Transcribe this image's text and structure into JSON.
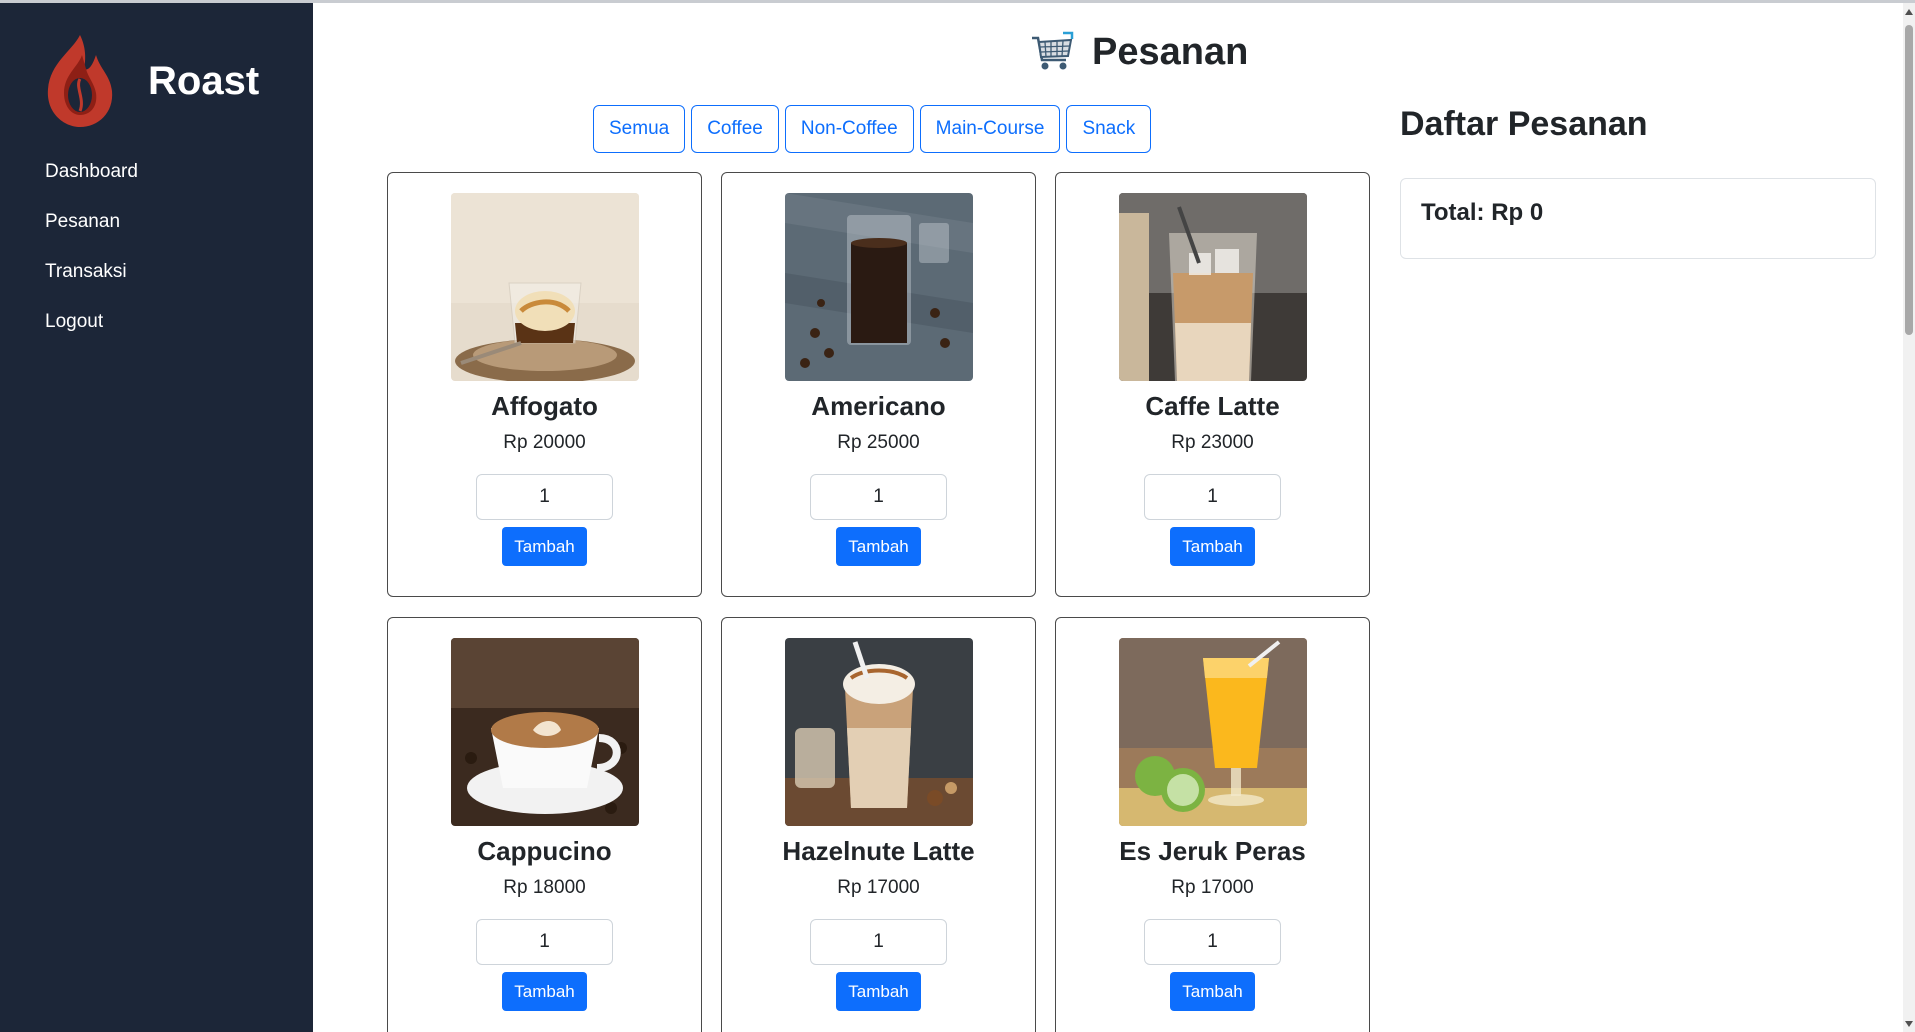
{
  "brand": {
    "name": "Roast",
    "logo_icon": "flame-coffee-bean-icon"
  },
  "sidebar": {
    "items": [
      {
        "label": "Dashboard"
      },
      {
        "label": "Pesanan"
      },
      {
        "label": "Transaksi"
      },
      {
        "label": "Logout"
      }
    ]
  },
  "header": {
    "title": "Pesanan",
    "icon": "cart-icon"
  },
  "filters": [
    {
      "label": "Semua"
    },
    {
      "label": "Coffee"
    },
    {
      "label": "Non-Coffee"
    },
    {
      "label": "Main-Course"
    },
    {
      "label": "Snack"
    }
  ],
  "products": [
    {
      "name": "Affogato",
      "price": "Rp 20000",
      "qty": "1",
      "button": "Tambah"
    },
    {
      "name": "Americano",
      "price": "Rp 25000",
      "qty": "1",
      "button": "Tambah"
    },
    {
      "name": "Caffe Latte",
      "price": "Rp 23000",
      "qty": "1",
      "button": "Tambah"
    },
    {
      "name": "Cappucino",
      "price": "Rp 18000",
      "qty": "1",
      "button": "Tambah"
    },
    {
      "name": "Hazelnute Latte",
      "price": "Rp 17000",
      "qty": "1",
      "button": "Tambah"
    },
    {
      "name": "Es Jeruk Peras",
      "price": "Rp 17000",
      "qty": "1",
      "button": "Tambah"
    }
  ],
  "order": {
    "title": "Daftar Pesanan",
    "total": "Total: Rp 0"
  },
  "colors": {
    "sidebar": "#1c2638",
    "accent": "#0d6efd",
    "logo": "#c0392b"
  }
}
